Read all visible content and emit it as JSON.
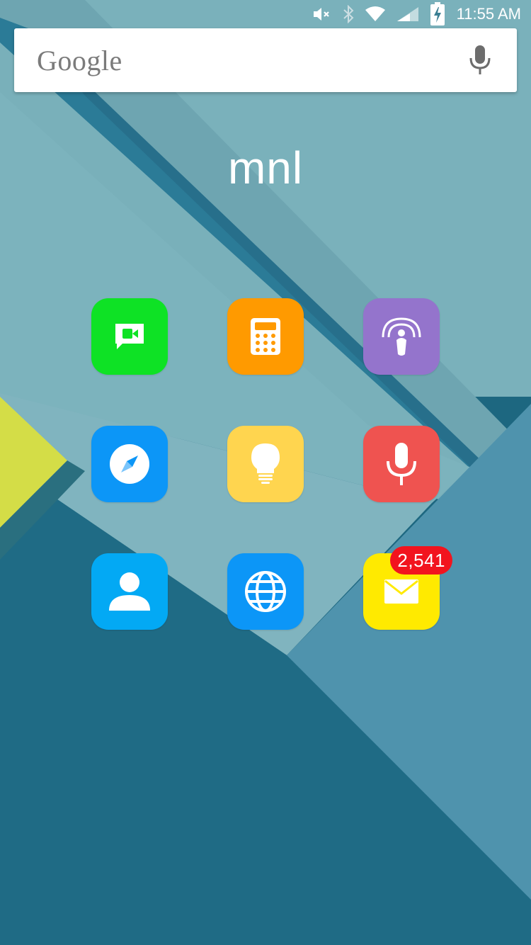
{
  "status_bar": {
    "time": "11:55 AM",
    "icons": [
      "mute-icon",
      "bluetooth-icon",
      "wifi-icon",
      "signal-icon",
      "battery-charging-icon"
    ]
  },
  "search": {
    "logo_text": "Google",
    "mic_icon": "microphone-icon"
  },
  "folder": {
    "title": "mnl"
  },
  "apps": [
    {
      "icon": "facetime-icon",
      "color": "#0ee225"
    },
    {
      "icon": "calculator-icon",
      "color": "#ff9a00"
    },
    {
      "icon": "podcasts-icon",
      "color": "#9474cc"
    },
    {
      "icon": "compass-icon",
      "color": "#0c96f7"
    },
    {
      "icon": "lightbulb-icon",
      "color": "#ffd54f"
    },
    {
      "icon": "voice-recorder-icon",
      "color": "#ef5350"
    },
    {
      "icon": "contacts-icon",
      "color": "#03a9f4"
    },
    {
      "icon": "globe-icon",
      "color": "#0c96f7"
    },
    {
      "icon": "mail-icon",
      "color": "#ffea00",
      "badge": "2,541"
    }
  ],
  "colors": {
    "badge": "#f2141e",
    "wallpaper_light": "#77acb7",
    "wallpaper_dark": "#1f6b82",
    "wallpaper_accent": "#d9e24a"
  }
}
